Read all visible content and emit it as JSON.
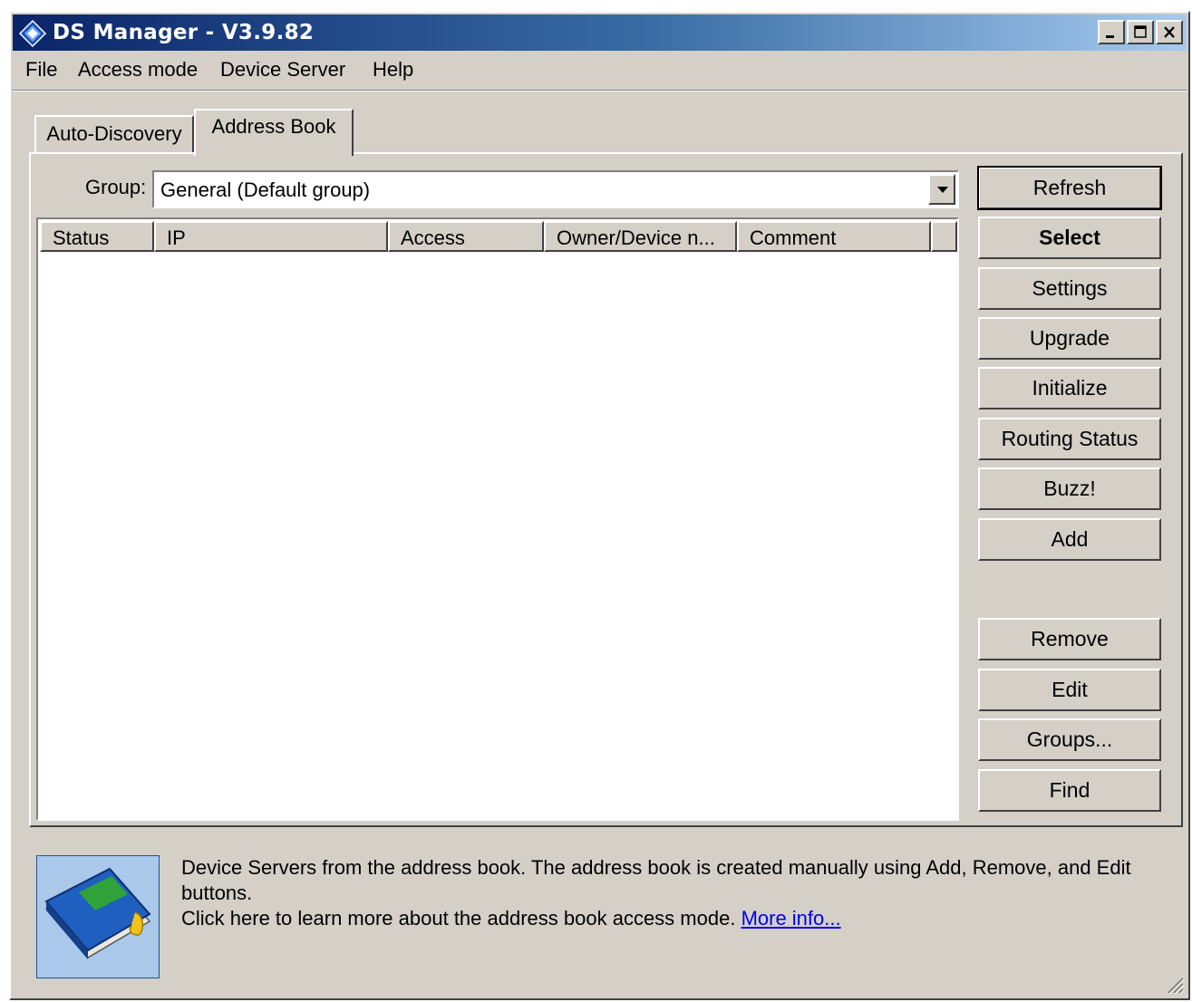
{
  "window": {
    "title": "DS Manager - V3.9.82",
    "controls": {
      "minimize": "minimize",
      "maximize": "maximize",
      "close": "close"
    }
  },
  "menu": {
    "items": [
      "File",
      "Access mode",
      "Device Server",
      "Help"
    ]
  },
  "tabs": {
    "items": [
      {
        "label": "Auto-Discovery",
        "active": false
      },
      {
        "label": "Address Book",
        "active": true
      }
    ]
  },
  "group": {
    "label": "Group:",
    "value": "General (Default group)"
  },
  "list": {
    "columns": [
      "Status",
      "IP",
      "Access",
      "Owner/Device n...",
      "Comment"
    ],
    "rows": []
  },
  "buttons": {
    "refresh": "Refresh",
    "select": "Select",
    "settings": "Settings",
    "upgrade": "Upgrade",
    "initialize": "Initialize",
    "routing_status": "Routing Status",
    "buzz": "Buzz!",
    "add": "Add",
    "remove": "Remove",
    "edit": "Edit",
    "groups": "Groups...",
    "find": "Find"
  },
  "footer": {
    "icon": "address-book-icon",
    "line1": "Device Servers from the address book. The address book is created manually using Add, Remove, and Edit buttons.",
    "line2": "Click here to learn more about the address book access mode.",
    "link": "More info..."
  },
  "colors": {
    "face": "#d4d0c8",
    "title_start": "#0a246a",
    "title_end": "#a6caf0",
    "link": "#0000ee"
  }
}
